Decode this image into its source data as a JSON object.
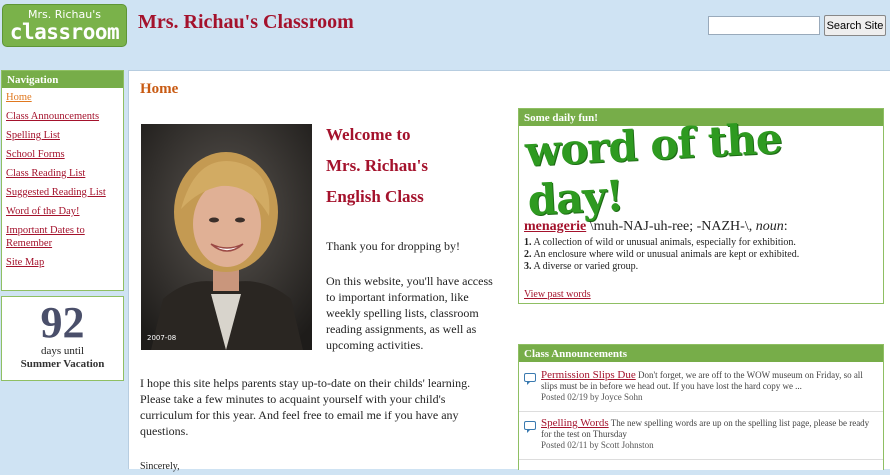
{
  "header": {
    "logo_line1": "Mrs. Richau's",
    "logo_line2": "classroom",
    "site_title": "Mrs. Richau's Classroom",
    "search_placeholder": "",
    "search_button": "Search Site"
  },
  "nav": {
    "heading": "Navigation",
    "items": [
      {
        "label": "Home"
      },
      {
        "label": "Class Announcements"
      },
      {
        "label": "Spelling List"
      },
      {
        "label": "School Forms"
      },
      {
        "label": "Class Reading List"
      },
      {
        "label": "Suggested Reading List"
      },
      {
        "label": "Word of the Day!"
      },
      {
        "label": "Important Dates to Remember"
      },
      {
        "label": "Site Map"
      }
    ]
  },
  "countdown": {
    "days": "92",
    "unit": "days until",
    "target": "Summer Vacation"
  },
  "main": {
    "heading": "Home",
    "photo_caption": "2007-08",
    "welcome_line1": "Welcome to",
    "welcome_line2": "Mrs. Richau's",
    "welcome_line3": "English Class",
    "thanks": "Thank you for dropping by!",
    "intro": "On this website, you'll have access to important information, like weekly spelling lists, classroom reading assignments, as well as upcoming activities.",
    "hope": "I hope this site helps parents stay up-to-date on their childs' learning. Please take a few minutes to acquaint yourself with your child's curriculum for this year. And feel free to email me if you have any questions.",
    "sincerely": "Sincerely,"
  },
  "daily": {
    "heading": "Some daily fun!",
    "banner": "word of the day!",
    "word": "menagerie",
    "pronunciation": " \\muh-NAJ-uh-ree; -NAZH-\\, ",
    "pos": "noun",
    "definitions": [
      {
        "num": "1.",
        "text": " A collection of wild or unusual animals, especially for exhibition."
      },
      {
        "num": "2.",
        "text": " An enclosure where wild or unusual animals are kept or exhibited."
      },
      {
        "num": "3.",
        "text": " A diverse or varied group."
      }
    ],
    "view_past": "View past words"
  },
  "announcements": {
    "heading": "Class Announcements",
    "items": [
      {
        "title": "Permission Slips Due",
        "body": " Don't forget, we are off to the WOW museum on Friday, so all slips must be in before we head out. If you have lost the hard copy we ...",
        "meta": "Posted 02/19 by Joyce Sohn"
      },
      {
        "title": "Spelling Words",
        "body": " The new spelling words are up on the spelling list page, please be ready for the test on Thursday",
        "meta": "Posted 02/11 by Scott Johnston"
      }
    ]
  },
  "colors": {
    "accent_green": "#77ad49",
    "title_red": "#a4122c",
    "heading_orange": "#c85a12",
    "background_blue": "#cfe3f3"
  }
}
